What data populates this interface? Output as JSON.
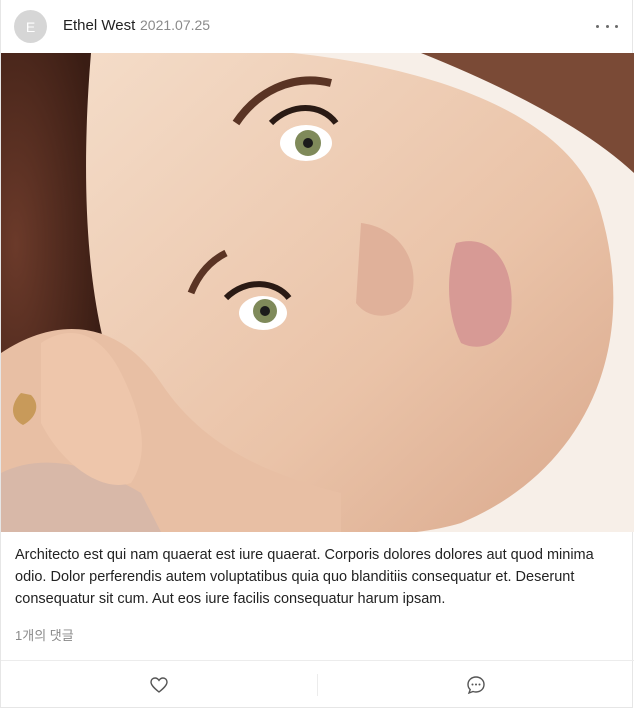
{
  "post": {
    "avatar_initial": "E",
    "author": "Ethel West",
    "date": "2021.07.25",
    "body": "Architecto est qui nam quaerat est iure quaerat. Corporis dolores dolores aut quod minima odio. Dolor perferendis autem voluptatibus quia quo blanditiis consequatur et. Deserunt consequatur sit cum. Aut eos iure facilis consequatur harum ipsam.",
    "comment_count_label": "1개의 댓글"
  },
  "icons": {
    "more": "more-horizontal-icon",
    "like": "heart-icon",
    "comment": "comment-icon"
  }
}
